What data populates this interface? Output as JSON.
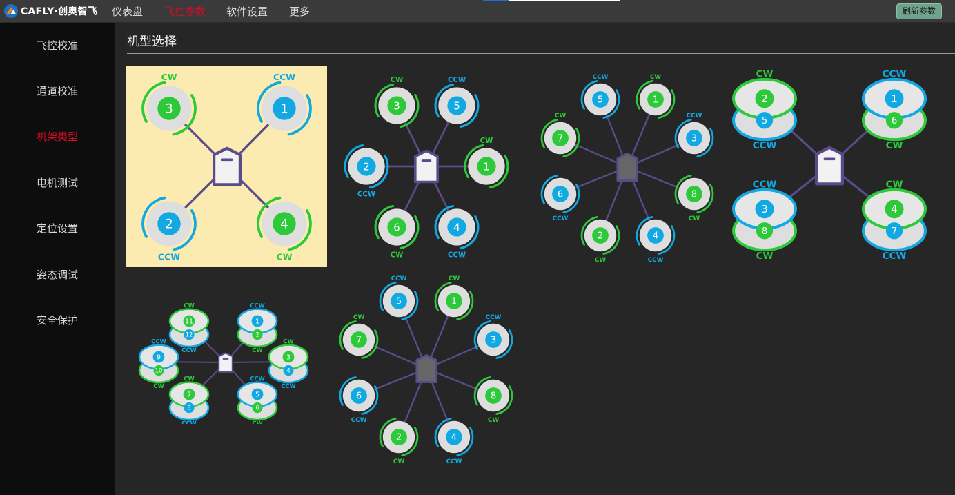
{
  "brand": {
    "text": "CAFLY·创奥智飞"
  },
  "nav": [
    {
      "label": "仪表盘",
      "active": false
    },
    {
      "label": "飞控参数",
      "active": true
    },
    {
      "label": "软件设置",
      "active": false
    },
    {
      "label": "更多",
      "active": false
    }
  ],
  "refresh_button": {
    "label": "刷新参数"
  },
  "sidebar": {
    "items": [
      {
        "label": "飞控校准",
        "active": false
      },
      {
        "label": "通道校准",
        "active": false
      },
      {
        "label": "机架类型",
        "active": true
      },
      {
        "label": "电机测试",
        "active": false
      },
      {
        "label": "定位设置",
        "active": false
      },
      {
        "label": "姿态调试",
        "active": false
      },
      {
        "label": "安全保护",
        "active": false
      }
    ]
  },
  "section": {
    "title": "机型选择"
  },
  "colors": {
    "cw": "#2ec93a",
    "ccw": "#12a9e3",
    "arm": "#5b4b8a",
    "selected_bg": "#fcebb0",
    "accent_red": "#d40d26"
  },
  "labels": {
    "cw": "CW",
    "ccw": "CCW"
  },
  "frames": [
    {
      "id": "quad-x",
      "selected": true,
      "motors": [
        {
          "n": "1",
          "dir": "ccw"
        },
        {
          "n": "2",
          "dir": "ccw"
        },
        {
          "n": "3",
          "dir": "cw"
        },
        {
          "n": "4",
          "dir": "cw"
        }
      ]
    },
    {
      "id": "hexa-x",
      "selected": false,
      "motors": [
        {
          "n": "1",
          "dir": "cw"
        },
        {
          "n": "2",
          "dir": "ccw"
        },
        {
          "n": "3",
          "dir": "cw"
        },
        {
          "n": "4",
          "dir": "ccw"
        },
        {
          "n": "5",
          "dir": "ccw"
        },
        {
          "n": "6",
          "dir": "cw"
        }
      ]
    },
    {
      "id": "octo-x",
      "selected": false,
      "motors": [
        {
          "n": "1",
          "dir": "cw"
        },
        {
          "n": "2",
          "dir": "cw"
        },
        {
          "n": "3",
          "dir": "ccw"
        },
        {
          "n": "4",
          "dir": "ccw"
        },
        {
          "n": "5",
          "dir": "ccw"
        },
        {
          "n": "6",
          "dir": "ccw"
        },
        {
          "n": "7",
          "dir": "cw"
        },
        {
          "n": "8",
          "dir": "cw"
        }
      ]
    },
    {
      "id": "octo-quad-x8",
      "selected": false,
      "motors": [
        {
          "top": "2",
          "top_dir": "cw",
          "bottom": "5",
          "bottom_dir": "ccw"
        },
        {
          "top": "1",
          "top_dir": "ccw",
          "bottom": "6",
          "bottom_dir": "cw"
        },
        {
          "top": "3",
          "top_dir": "ccw",
          "bottom": "8",
          "bottom_dir": "cw"
        },
        {
          "top": "4",
          "top_dir": "cw",
          "bottom": "7",
          "bottom_dir": "ccw"
        }
      ]
    },
    {
      "id": "dodeca-hexa-y6",
      "selected": false,
      "motors": [
        {
          "top": "11",
          "top_dir": "cw",
          "bottom": "12",
          "bottom_dir": "ccw"
        },
        {
          "top": "1",
          "top_dir": "ccw",
          "bottom": "2",
          "bottom_dir": "cw"
        },
        {
          "top": "9",
          "top_dir": "ccw",
          "bottom": "10",
          "bottom_dir": "cw"
        },
        {
          "top": "3",
          "top_dir": "cw",
          "bottom": "4",
          "bottom_dir": "ccw"
        },
        {
          "top": "7",
          "top_dir": "cw",
          "bottom": "8",
          "bottom_dir": "ccw"
        },
        {
          "top": "5",
          "top_dir": "ccw",
          "bottom": "6",
          "bottom_dir": "cw"
        }
      ]
    },
    {
      "id": "octo-plus",
      "selected": false,
      "motors": [
        {
          "n": "1",
          "dir": "cw"
        },
        {
          "n": "2",
          "dir": "cw"
        },
        {
          "n": "3",
          "dir": "ccw"
        },
        {
          "n": "4",
          "dir": "ccw"
        },
        {
          "n": "5",
          "dir": "ccw"
        },
        {
          "n": "6",
          "dir": "ccw"
        },
        {
          "n": "7",
          "dir": "cw"
        },
        {
          "n": "8",
          "dir": "cw"
        }
      ]
    }
  ]
}
